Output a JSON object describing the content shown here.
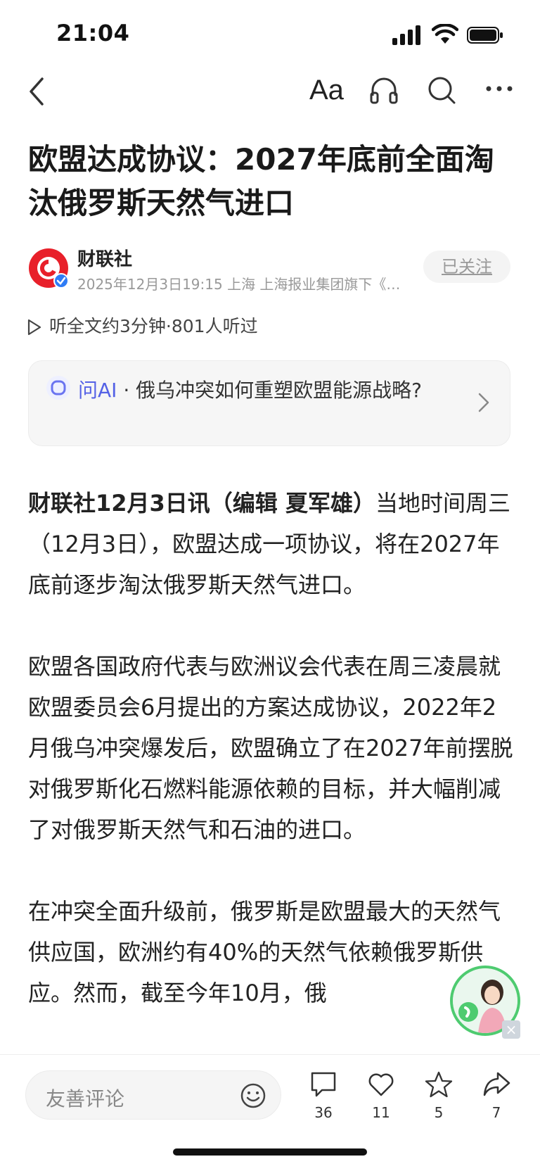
{
  "status_bar": {
    "time": "21:04"
  },
  "nav": {
    "font_icon": "Aa"
  },
  "article": {
    "title": "欧盟达成协议：2027年底前全面淘汰俄罗斯天然气进口",
    "author": {
      "name": "财联社",
      "meta": "2025年12月3日19:15 上海 上海报业集团旗下《…",
      "follow_label": "已关注"
    },
    "listen_label": "听全文约3分钟·801人听过",
    "ask_ai": {
      "label": "问AI",
      "separator": "·",
      "question": "俄乌冲突如何重塑欧盟能源战略?"
    },
    "paragraphs": [
      {
        "bold": "财联社12月3日讯（编辑 夏军雄）",
        "text": "当地时间周三（12月3日），欧盟达成一项协议，将在2027年底前逐步淘汰俄罗斯天然气进口。"
      },
      {
        "bold": "",
        "text": "欧盟各国政府代表与欧洲议会代表在周三凌晨就欧盟委员会6月提出的方案达成协议，2022年2月俄乌冲突爆发后，欧盟确立了在2027年前摆脱对俄罗斯化石燃料能源依赖的目标，并大幅削减了对俄罗斯天然气和石油的进口。"
      },
      {
        "bold": "",
        "text": "在冲突全面升级前，俄罗斯是欧盟最大的天然气供应国，欧洲约有40%的天然气依赖俄罗斯供应。然而，截至今年10月，俄"
      }
    ]
  },
  "bottom_bar": {
    "comment_placeholder": "友善评论",
    "comments": "36",
    "likes": "11",
    "favorites": "5",
    "shares": "7"
  },
  "colors": {
    "accent": "#5562e6",
    "brand_red": "#e8202a",
    "assistant_green": "#4ecb70"
  }
}
